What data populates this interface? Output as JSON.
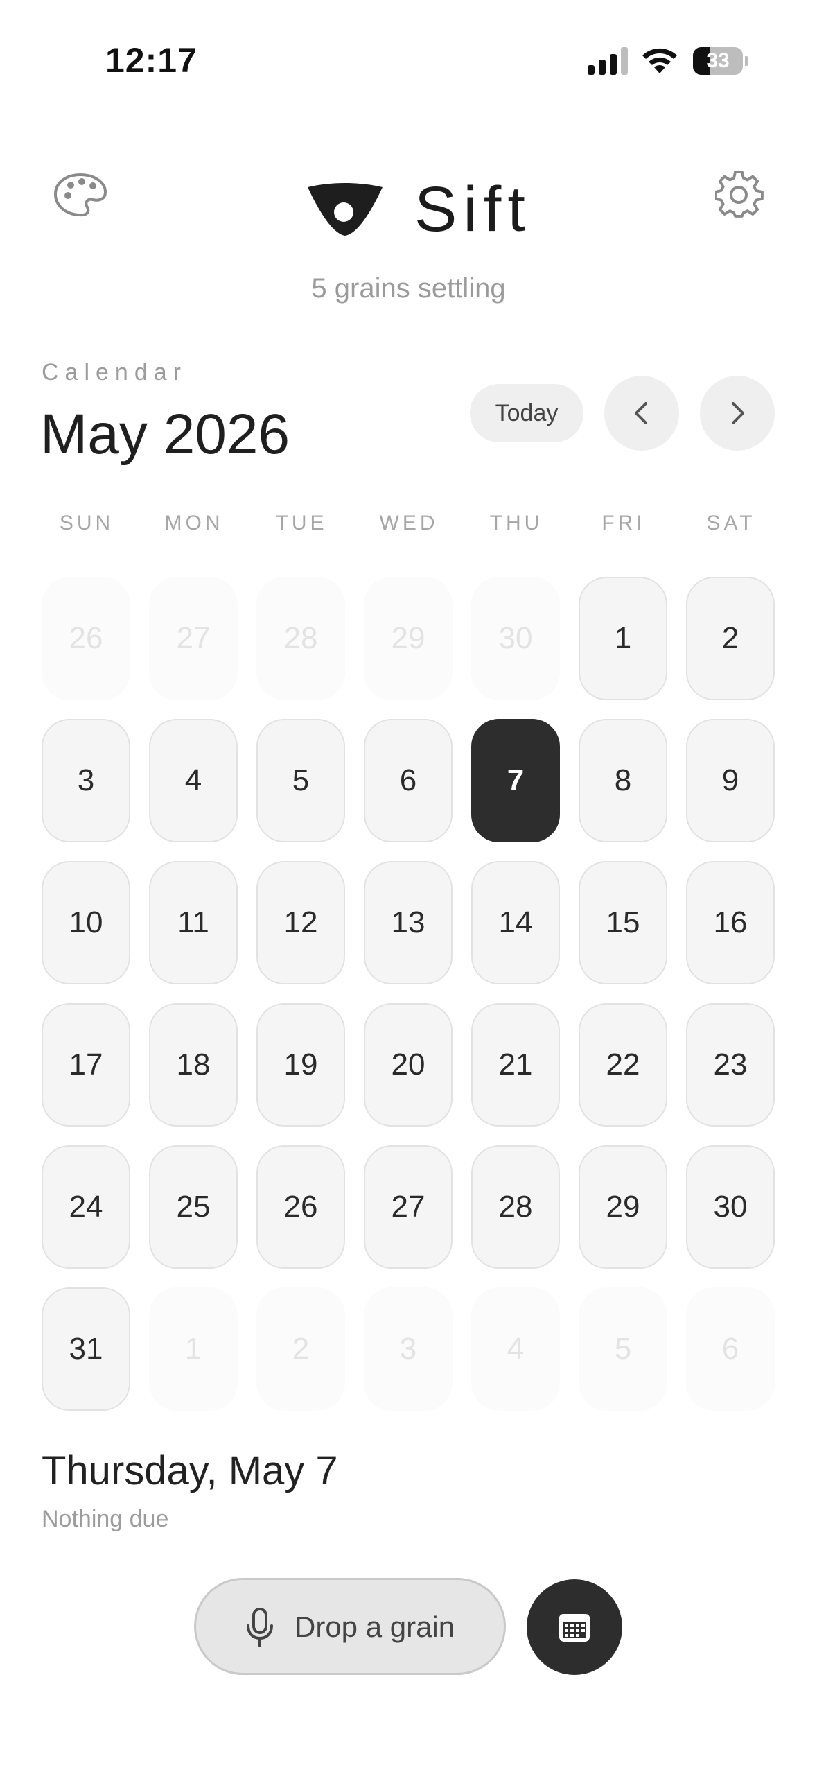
{
  "status_bar": {
    "time": "12:17",
    "battery_level": "33",
    "battery_fraction": 0.33,
    "signal_bars": 4,
    "icons": [
      "cellular-signal-icon",
      "wifi-icon",
      "battery-icon"
    ]
  },
  "header": {
    "app_title": "Sift",
    "subtitle": "5 grains settling",
    "left_icon": "palette-icon",
    "right_icon": "gear-icon",
    "logo_icon": "sift-logo"
  },
  "calendar": {
    "section_label": "Calendar",
    "month_title": "May 2026",
    "today_label": "Today",
    "prev_icon": "chevron-left-icon",
    "next_icon": "chevron-right-icon",
    "weekdays": [
      "SUN",
      "MON",
      "TUE",
      "WED",
      "THU",
      "FRI",
      "SAT"
    ],
    "weeks": [
      [
        {
          "day": "26",
          "state": "outside"
        },
        {
          "day": "27",
          "state": "outside"
        },
        {
          "day": "28",
          "state": "outside"
        },
        {
          "day": "29",
          "state": "outside"
        },
        {
          "day": "30",
          "state": "outside"
        },
        {
          "day": "1",
          "state": "current"
        },
        {
          "day": "2",
          "state": "current"
        }
      ],
      [
        {
          "day": "3",
          "state": "current"
        },
        {
          "day": "4",
          "state": "current"
        },
        {
          "day": "5",
          "state": "current"
        },
        {
          "day": "6",
          "state": "current"
        },
        {
          "day": "7",
          "state": "selected"
        },
        {
          "day": "8",
          "state": "current"
        },
        {
          "day": "9",
          "state": "current"
        }
      ],
      [
        {
          "day": "10",
          "state": "current"
        },
        {
          "day": "11",
          "state": "current"
        },
        {
          "day": "12",
          "state": "current"
        },
        {
          "day": "13",
          "state": "current"
        },
        {
          "day": "14",
          "state": "current"
        },
        {
          "day": "15",
          "state": "current"
        },
        {
          "day": "16",
          "state": "current"
        }
      ],
      [
        {
          "day": "17",
          "state": "current"
        },
        {
          "day": "18",
          "state": "current"
        },
        {
          "day": "19",
          "state": "current"
        },
        {
          "day": "20",
          "state": "current"
        },
        {
          "day": "21",
          "state": "current"
        },
        {
          "day": "22",
          "state": "current"
        },
        {
          "day": "23",
          "state": "current"
        }
      ],
      [
        {
          "day": "24",
          "state": "current"
        },
        {
          "day": "25",
          "state": "current"
        },
        {
          "day": "26",
          "state": "current"
        },
        {
          "day": "27",
          "state": "current"
        },
        {
          "day": "28",
          "state": "current"
        },
        {
          "day": "29",
          "state": "current"
        },
        {
          "day": "30",
          "state": "current"
        }
      ],
      [
        {
          "day": "31",
          "state": "current"
        },
        {
          "day": "1",
          "state": "outside"
        },
        {
          "day": "2",
          "state": "outside"
        },
        {
          "day": "3",
          "state": "outside"
        },
        {
          "day": "4",
          "state": "outside"
        },
        {
          "day": "5",
          "state": "outside"
        },
        {
          "day": "6",
          "state": "outside"
        }
      ]
    ]
  },
  "selected_day": {
    "date_label": "Thursday, May 7",
    "status": "Nothing due"
  },
  "actions": {
    "drop_label": "Drop a grain",
    "drop_icon": "microphone-icon",
    "calendar_icon": "calendar-icon"
  },
  "colors": {
    "selected_day_bg": "#2d2d2d",
    "day_bg": "#f5f5f5",
    "muted_text": "#9c9c9c"
  }
}
